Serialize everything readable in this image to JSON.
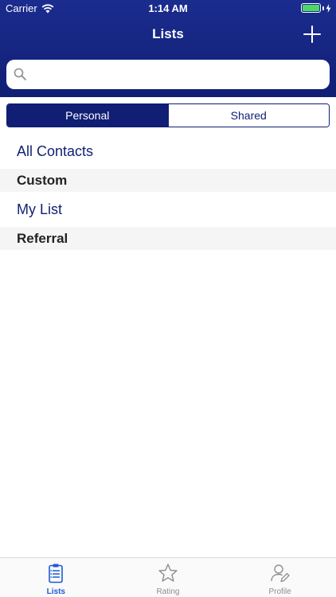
{
  "status_bar": {
    "carrier": "Carrier",
    "time": "1:14 AM"
  },
  "nav": {
    "title": "Lists",
    "add_icon": "plus-icon"
  },
  "search": {
    "placeholder": "",
    "value": ""
  },
  "segments": [
    {
      "label": "Personal",
      "active": true
    },
    {
      "label": "Shared",
      "active": false
    }
  ],
  "list": {
    "all_contacts": "All Contacts",
    "sections": [
      {
        "header": "Custom",
        "items": [
          "My List"
        ]
      },
      {
        "header": "Referral",
        "items": []
      }
    ]
  },
  "tabs": [
    {
      "label": "Lists",
      "icon": "clipboard-list-icon",
      "active": true
    },
    {
      "label": "Rating",
      "icon": "star-icon",
      "active": false
    },
    {
      "label": "Profile",
      "icon": "user-edit-icon",
      "active": false
    }
  ],
  "colors": {
    "brand": "#101f74",
    "accent": "#1d5bd6",
    "battery": "#4cd964"
  }
}
